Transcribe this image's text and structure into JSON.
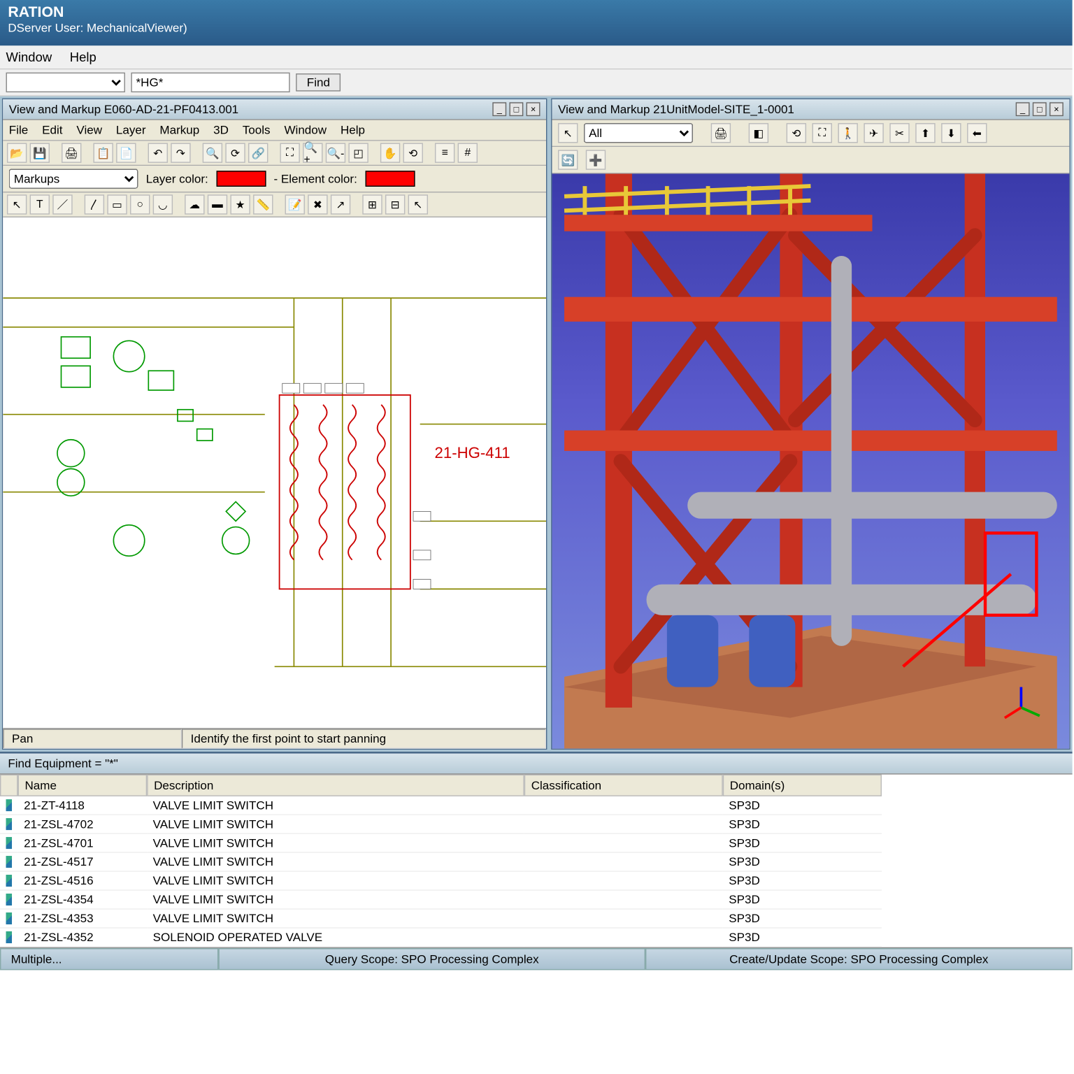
{
  "title": {
    "line1": "RATION",
    "line2": "DServer User: MechanicalViewer)"
  },
  "menubar": [
    "Window",
    "Help"
  ],
  "search": {
    "value": "*HG*",
    "find_label": "Find"
  },
  "left_pane": {
    "title": "View and Markup E060-AD-21-PF0413.001",
    "menus": [
      "File",
      "Edit",
      "View",
      "Layer",
      "Markup",
      "3D",
      "Tools",
      "Window",
      "Help"
    ],
    "layer_dropdown": "Markups",
    "layer_color_label": "Layer color:",
    "element_color_label": "- Element color:",
    "callout": "21-HG-411",
    "status_mode": "Pan",
    "status_hint": "Identify the first point to start panning"
  },
  "right_pane": {
    "title": "View and Markup 21UnitModel-SITE_1-0001",
    "filter": "All"
  },
  "results": {
    "title": "Find Equipment = \"*\"",
    "columns": [
      "",
      "Name",
      "Description",
      "Classification",
      "Domain(s)"
    ],
    "rows": [
      {
        "name": "21-ZT-4118",
        "desc": "VALVE LIMIT SWITCH",
        "cls": "",
        "dom": "SP3D"
      },
      {
        "name": "21-ZSL-4702",
        "desc": "VALVE LIMIT SWITCH",
        "cls": "",
        "dom": "SP3D"
      },
      {
        "name": "21-ZSL-4701",
        "desc": "VALVE LIMIT SWITCH",
        "cls": "",
        "dom": "SP3D"
      },
      {
        "name": "21-ZSL-4517",
        "desc": "VALVE LIMIT SWITCH",
        "cls": "",
        "dom": "SP3D"
      },
      {
        "name": "21-ZSL-4516",
        "desc": "VALVE LIMIT SWITCH",
        "cls": "",
        "dom": "SP3D"
      },
      {
        "name": "21-ZSL-4354",
        "desc": "VALVE LIMIT SWITCH",
        "cls": "",
        "dom": "SP3D"
      },
      {
        "name": "21-ZSL-4353",
        "desc": "VALVE LIMIT SWITCH",
        "cls": "",
        "dom": "SP3D"
      },
      {
        "name": "21-ZSL-4352",
        "desc": "SOLENOID OPERATED VALVE",
        "cls": "",
        "dom": "SP3D"
      }
    ]
  },
  "bottombar": {
    "left": "Multiple...",
    "mid": "Query Scope: SPO Processing Complex",
    "right": "Create/Update Scope: SPO Processing Complex"
  }
}
